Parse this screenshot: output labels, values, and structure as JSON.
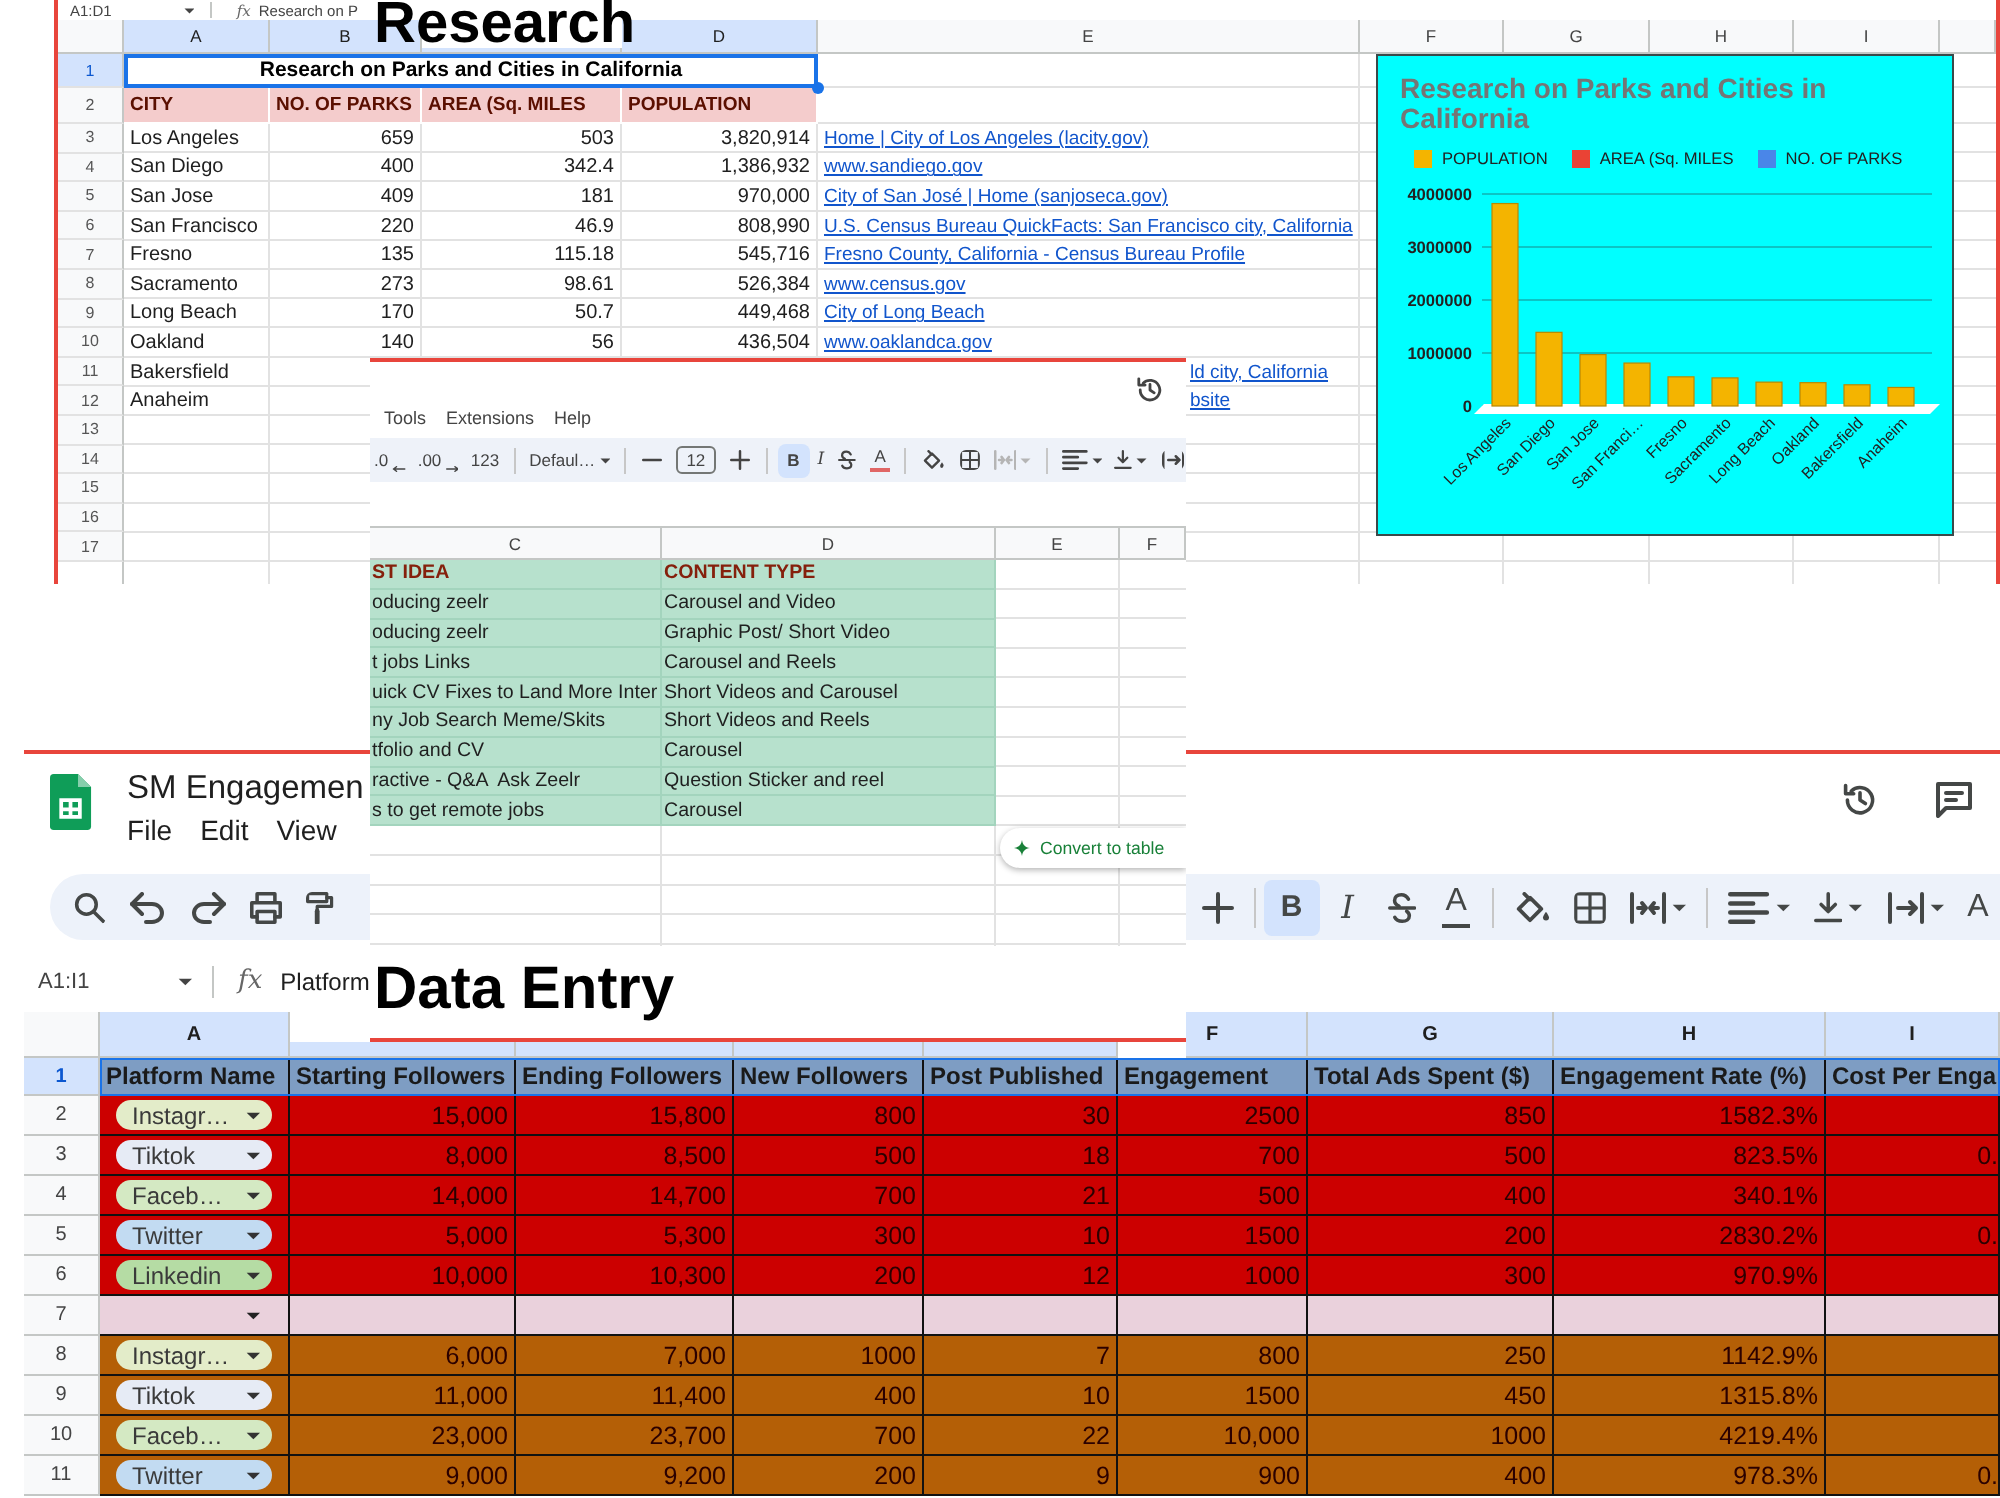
{
  "research_sheet": {
    "formula_bar": {
      "name_box": "A1:D1",
      "fx": "fx",
      "text": "Research on P"
    },
    "heading": "Research",
    "column_headers": [
      {
        "letter": "A",
        "selected": true
      },
      {
        "letter": "B",
        "selected": true
      },
      {
        "selected": true
      },
      {
        "letter": "D",
        "selected": true
      },
      {
        "letter": "E",
        "selected": false
      },
      {
        "letter": "F",
        "selected": false
      },
      {
        "letter": "G",
        "selected": false
      },
      {
        "letter": "H",
        "selected": false
      },
      {
        "letter": "I",
        "selected": false
      }
    ],
    "row_numbers": [
      {
        "label": "1",
        "selected": true
      },
      {
        "label": "2",
        "selected": false
      },
      {
        "label": "3",
        "selected": false
      },
      {
        "label": "4",
        "selected": false
      },
      {
        "label": "5",
        "selected": false
      },
      {
        "label": "6",
        "selected": false
      },
      {
        "label": "7",
        "selected": false
      },
      {
        "label": "8",
        "selected": false
      },
      {
        "label": "9",
        "selected": false
      },
      {
        "label": "10",
        "selected": false
      },
      {
        "label": "11",
        "selected": false
      },
      {
        "label": "12",
        "selected": false
      },
      {
        "label": "13",
        "selected": false
      },
      {
        "label": "14",
        "selected": false
      },
      {
        "label": "15",
        "selected": false
      },
      {
        "label": "16",
        "selected": false
      },
      {
        "label": "17",
        "selected": false
      }
    ],
    "title": {
      "text": "Research on Parks and Cities in California",
      "selected": true
    },
    "header": [
      "CITY",
      "NO. OF PARKS",
      "AREA (Sq. MILES",
      "POPULATION"
    ],
    "rows": [
      {
        "city": "Los Angeles",
        "parks": "659",
        "area": "503",
        "population": "3,820,914",
        "link": "Home | City of Los Angeles (lacity.gov)"
      },
      {
        "city": "San Diego",
        "parks": "400",
        "area": "342.4",
        "population": "1,386,932",
        "link": "www.sandiego.gov"
      },
      {
        "city": "San Jose",
        "parks": "409",
        "area": "181",
        "population": "970,000",
        "link": "City of San José | Home (sanjoseca.gov)"
      },
      {
        "city": "San Francisco",
        "parks": "220",
        "area": "46.9",
        "population": "808,990",
        "link": "U.S. Census Bureau QuickFacts: San Francisco city, California"
      },
      {
        "city": "Fresno",
        "parks": "135",
        "area": "115.18",
        "population": "545,716",
        "link": "Fresno County, California - Census Bureau Profile"
      },
      {
        "city": "Sacramento",
        "parks": "273",
        "area": "98.61",
        "population": "526,384",
        "link": "www.census.gov"
      },
      {
        "city": "Long Beach",
        "parks": "170",
        "area": "50.7",
        "population": "449,468",
        "link": "City of Long Beach"
      },
      {
        "city": "Oakland",
        "parks": "140",
        "area": "56",
        "population": "436,504",
        "link": "www.oaklandca.gov"
      },
      {
        "city": "Bakersfield",
        "link": "ld city, California"
      },
      {
        "city": "Anaheim",
        "link": "bsite"
      }
    ],
    "chart": {
      "chart_data": {
        "type": "bar",
        "title": "Research on Parks and Cities in California",
        "categories": [
          "Los Angeles",
          "San Diego",
          "San Jose",
          "San Franci…",
          "Fresno",
          "Sacramento",
          "Long Beach",
          "Oakland",
          "Bakersfield",
          "Anaheim"
        ],
        "series": [
          {
            "name": "POPULATION",
            "color": "#f4b400",
            "values": [
              3820000,
              1390000,
              970000,
              810000,
              550000,
              530000,
              450000,
              440000,
              400000,
              350000
            ]
          },
          {
            "name": "AREA (Sq. MILES",
            "color": "#ea4335",
            "values": [
              null,
              null,
              null,
              null,
              null,
              null,
              null,
              null,
              null,
              null
            ]
          },
          {
            "name": "NO. OF PARKS",
            "color": "#4a86e8",
            "values": [
              null,
              null,
              null,
              null,
              null,
              null,
              null,
              null,
              null,
              null
            ]
          }
        ],
        "ylim": [
          0,
          4000000
        ],
        "yticks": [
          0,
          1000000,
          2000000,
          3000000,
          4000000
        ],
        "grid": true
      }
    }
  },
  "ideas_sheet": {
    "menu": [
      "Tools",
      "Extensions",
      "Help"
    ],
    "toolbar": [
      {
        "kind": "decrease-decimal",
        "label": ".0",
        "disabled": false
      },
      {
        "kind": "increase-decimal",
        "label": ".00",
        "disabled": false
      },
      {
        "kind": "number-format",
        "label": "123",
        "disabled": false
      },
      {
        "kind": "divider"
      },
      {
        "kind": "font",
        "label": "Defaul…",
        "dropdown": true,
        "disabled": false
      },
      {
        "kind": "divider"
      },
      {
        "kind": "minus",
        "disabled": false
      },
      {
        "kind": "font-size",
        "label": "12",
        "disabled": false
      },
      {
        "kind": "plus",
        "disabled": false
      },
      {
        "kind": "divider"
      },
      {
        "kind": "bold",
        "label": "B",
        "on": true,
        "disabled": false
      },
      {
        "kind": "italic",
        "label": "I",
        "on": false,
        "disabled": false
      },
      {
        "kind": "strike",
        "on": false,
        "disabled": false
      },
      {
        "kind": "text-color",
        "label": "A",
        "color": "#e06666",
        "disabled": false
      },
      {
        "kind": "divider"
      },
      {
        "kind": "fill",
        "disabled": false
      },
      {
        "kind": "borders",
        "disabled": false
      },
      {
        "kind": "merge",
        "dropdown": true,
        "disabled": true
      },
      {
        "kind": "divider"
      },
      {
        "kind": "align",
        "dropdown": true,
        "disabled": false
      },
      {
        "kind": "valign",
        "dropdown": true,
        "disabled": false
      },
      {
        "kind": "wrap",
        "dropdown": false,
        "disabled": false
      }
    ],
    "column_headers": [
      "C",
      "D",
      "E",
      "F"
    ],
    "rows": [
      {
        "kind": "header",
        "column_c": "ST IDEA",
        "column_d": "CONTENT TYPE"
      },
      {
        "kind": "data",
        "column_c": "oducing zeelr",
        "column_d": "Carousel and Video"
      },
      {
        "kind": "data",
        "column_c": "oducing zeelr",
        "column_d": "Graphic Post/ Short Video"
      },
      {
        "kind": "data",
        "column_c": "t jobs Links",
        "column_d": "Carousel and Reels"
      },
      {
        "kind": "data",
        "column_c": "uick CV Fixes to Land More Inter",
        "column_d": "Short Videos and Carousel"
      },
      {
        "kind": "data",
        "column_c": "ny Job Search Meme/Skits",
        "column_d": "Short Videos and Reels"
      },
      {
        "kind": "data",
        "column_c": "tfolio and CV",
        "column_d": "Carousel"
      },
      {
        "kind": "data",
        "column_c": "ractive - Q&A  Ask Zeelr",
        "column_d": "Question Sticker and reel"
      },
      {
        "kind": "data",
        "column_c": "s to get remote jobs",
        "column_d": "Carousel"
      }
    ],
    "convert_button": "Convert to table"
  },
  "engagement_sheet": {
    "title": "SM Engagemen",
    "menu": [
      "File",
      "Edit",
      "View"
    ],
    "toolbar_left": [
      {
        "kind": "search"
      },
      {
        "kind": "undo"
      },
      {
        "kind": "redo"
      },
      {
        "kind": "print"
      },
      {
        "kind": "paint-format"
      }
    ],
    "toolbar_right": [
      {
        "kind": "plus"
      },
      {
        "kind": "divider"
      },
      {
        "kind": "bold",
        "label": "B",
        "on": true
      },
      {
        "kind": "italic",
        "label": "I",
        "on": false
      },
      {
        "kind": "strike",
        "on": false
      },
      {
        "kind": "text-color",
        "label": "A",
        "color": "#444746"
      },
      {
        "kind": "divider"
      },
      {
        "kind": "fill"
      },
      {
        "kind": "borders"
      },
      {
        "kind": "merge",
        "dropdown": true
      },
      {
        "kind": "divider"
      },
      {
        "kind": "align",
        "dropdown": true
      },
      {
        "kind": "valign",
        "dropdown": true
      },
      {
        "kind": "wrap",
        "dropdown": true
      },
      {
        "kind": "rotate",
        "label": "A"
      }
    ],
    "formula_bar": {
      "name_box": "A1:I1",
      "fx": "fx",
      "text": "Platform"
    },
    "heading": "Data Entry",
    "column_headers": [
      {
        "letter": "A",
        "selected": true
      },
      {
        "selected": true
      },
      {
        "selected": true
      },
      {
        "selected": true
      },
      {
        "selected": true
      },
      {
        "letter": "F",
        "selected": true
      },
      {
        "letter": "G",
        "selected": true
      },
      {
        "letter": "H",
        "selected": true
      },
      {
        "letter": "I",
        "selected": true
      }
    ],
    "row_numbers": [
      {
        "label": "1",
        "selected": true
      },
      {
        "label": "2",
        "selected": false
      },
      {
        "label": "3",
        "selected": false
      },
      {
        "label": "4",
        "selected": false
      },
      {
        "label": "5",
        "selected": false
      },
      {
        "label": "6",
        "selected": false
      },
      {
        "label": "7",
        "selected": false
      },
      {
        "label": "8",
        "selected": false
      },
      {
        "label": "9",
        "selected": false
      },
      {
        "label": "10",
        "selected": false
      },
      {
        "label": "11",
        "selected": false
      }
    ],
    "header": {
      "selected": true,
      "cells": [
        "Platform Name",
        "Starting Followers",
        "Ending Followers",
        "New Followers",
        "Post Published",
        "Engagement",
        "Total Ads Spent ($)",
        "Engagement Rate (%)",
        "Cost Per Enga"
      ]
    },
    "rows": [
      {
        "kind": "data",
        "color": "#cc0000",
        "platform": {
          "label": "Instagr…",
          "color": "#e3ecc9"
        },
        "cells": [
          "15,000",
          "15,800",
          "800",
          "30",
          "2500",
          "850",
          "1582.3%"
        ]
      },
      {
        "kind": "data",
        "color": "#cc0000",
        "platform": {
          "label": "Tiktok",
          "color": "#e6ebf5"
        },
        "cells": [
          "8,000",
          "8,500",
          "500",
          "18",
          "700",
          "500",
          "823.5%",
          "0."
        ]
      },
      {
        "kind": "data",
        "color": "#cc0000",
        "platform": {
          "label": "Faceb…",
          "color": "#d4e9c3"
        },
        "cells": [
          "14,000",
          "14,700",
          "700",
          "21",
          "500",
          "400",
          "340.1%"
        ]
      },
      {
        "kind": "data",
        "color": "#cc0000",
        "platform": {
          "label": "Twitter",
          "color": "#c2dbf2"
        },
        "cells": [
          "5,000",
          "5,300",
          "300",
          "10",
          "1500",
          "200",
          "2830.2%",
          "0."
        ]
      },
      {
        "kind": "data",
        "color": "#cc0000",
        "platform": {
          "label": "Linkedin",
          "color": "#b5dca4"
        },
        "cells": [
          "10,000",
          "10,300",
          "200",
          "12",
          "1000",
          "300",
          "970.9%"
        ]
      },
      {
        "kind": "blank",
        "color": "#ead1dc"
      },
      {
        "kind": "data",
        "color": "#b45f06",
        "platform": {
          "label": "Instagr…",
          "color": "#e3ecc9"
        },
        "cells": [
          "6,000",
          "7,000",
          "1000",
          "7",
          "800",
          "250",
          "1142.9%"
        ]
      },
      {
        "kind": "data",
        "color": "#b45f06",
        "platform": {
          "label": "Tiktok",
          "color": "#e6ebf5"
        },
        "cells": [
          "11,000",
          "11,400",
          "400",
          "10",
          "1500",
          "450",
          "1315.8%"
        ]
      },
      {
        "kind": "data",
        "color": "#b45f06",
        "platform": {
          "label": "Faceb…",
          "color": "#d4e9c3"
        },
        "cells": [
          "23,000",
          "23,700",
          "700",
          "22",
          "10,000",
          "1000",
          "4219.4%"
        ]
      },
      {
        "kind": "data",
        "color": "#b45f06",
        "platform": {
          "label": "Twitter",
          "color": "#c2dbf2"
        },
        "cells": [
          "9,000",
          "9,200",
          "200",
          "9",
          "900",
          "400",
          "978.3%",
          "0."
        ]
      }
    ]
  }
}
